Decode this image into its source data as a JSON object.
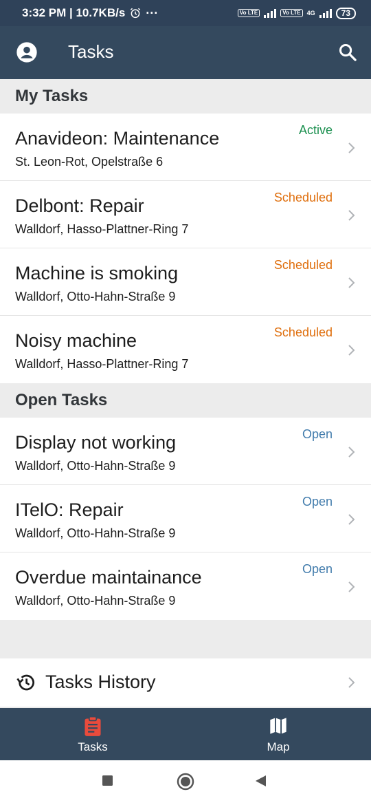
{
  "status_bar": {
    "time_speed": "3:32 PM | 10.7KB/s",
    "more_dots": "···",
    "volte1": "Vo LTE",
    "volte2": "Vo LTE",
    "network_badge": "4G",
    "battery": "73"
  },
  "app_bar": {
    "title": "Tasks"
  },
  "sections": {
    "my_tasks": {
      "label": "My Tasks",
      "items": [
        {
          "title": "Anavideon: Maintenance",
          "address": "St. Leon-Rot, Opelstraße 6",
          "status": "Active",
          "status_color": "#1a8f4e"
        },
        {
          "title": "Delbont: Repair",
          "address": "Walldorf, Hasso-Plattner-Ring 7",
          "status": "Scheduled",
          "status_color": "#df6e0c"
        },
        {
          "title": "Machine is smoking",
          "address": "Walldorf, Otto-Hahn-Straße 9",
          "status": "Scheduled",
          "status_color": "#df6e0c"
        },
        {
          "title": "Noisy machine",
          "address": "Walldorf, Hasso-Plattner-Ring 7",
          "status": "Scheduled",
          "status_color": "#df6e0c"
        }
      ]
    },
    "open_tasks": {
      "label": "Open Tasks",
      "items": [
        {
          "title": "Display not working",
          "address": "Walldorf, Otto-Hahn-Straße 9",
          "status": "Open",
          "status_color": "#427cac"
        },
        {
          "title": "ITelO: Repair",
          "address": "Walldorf, Otto-Hahn-Straße 9",
          "status": "Open",
          "status_color": "#427cac"
        },
        {
          "title": "Overdue maintainance",
          "address": "Walldorf, Otto-Hahn-Straße 9",
          "status": "Open",
          "status_color": "#427cac"
        }
      ]
    }
  },
  "history": {
    "label": "Tasks History"
  },
  "tab_bar": {
    "tasks_label": "Tasks",
    "map_label": "Map",
    "active_color": "#e94b3c"
  },
  "icons": {
    "account": "account-circle-icon",
    "search": "search-icon",
    "chevron": "chevron-right-icon",
    "history": "history-icon",
    "tasks": "clipboard-icon",
    "map": "map-icon"
  }
}
